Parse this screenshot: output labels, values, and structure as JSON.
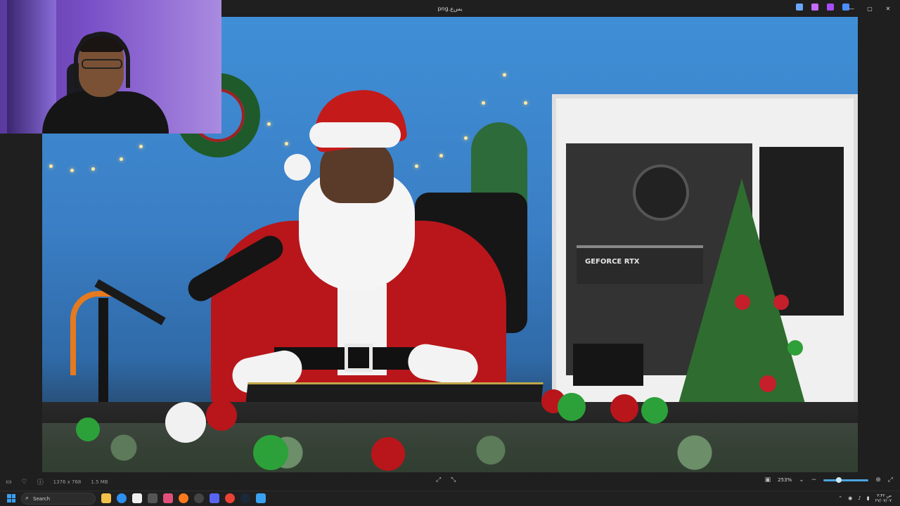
{
  "window": {
    "title": "png.یس‌ع",
    "controls": [
      "minimize",
      "maximize",
      "close"
    ],
    "title_tools": [
      "edit-icon",
      "copilot-icon",
      "designer-icon",
      "cloud-icon"
    ],
    "tool_colors": [
      "#6aa6ff",
      "#c66bff",
      "#a84cff",
      "#4c8dff"
    ]
  },
  "status": {
    "dimensions": "1376 x 768",
    "file_size": "1.5 MB",
    "zoom": "253%",
    "zoom_fraction": 0.28
  },
  "taskbar": {
    "search_placeholder": "Search",
    "apps": [
      "file-explorer",
      "edge",
      "microsoft-store",
      "camera",
      "app-pink",
      "firefox",
      "obs",
      "discord",
      "chrome",
      "steam",
      "paint"
    ],
    "app_colors": [
      "#f2c14a",
      "#2d8ff0",
      "#f0f0f0",
      "#555555",
      "#e0507a",
      "#ff7a1a",
      "#444444",
      "#5865f2",
      "#ea4335",
      "#1b2838",
      "#3aa0f0"
    ],
    "tray": {
      "time": "۳:۴۲ ص",
      "date": "۲۷/۰۷/۰۷"
    }
  },
  "photo": {
    "gpu_label": "GEFORCE RTX"
  }
}
